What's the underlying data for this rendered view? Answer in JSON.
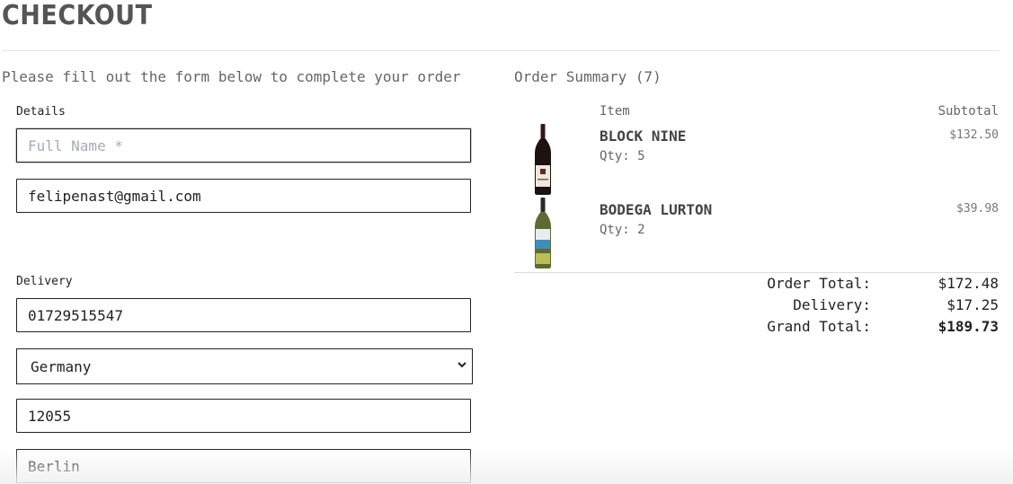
{
  "page": {
    "title": "CHECKOUT",
    "intro": "Please fill out the form below to complete your order"
  },
  "form": {
    "details_label": "Details",
    "full_name": {
      "value": "",
      "placeholder": "Full Name *"
    },
    "email": {
      "value": "felipenast@gmail.com"
    },
    "delivery_label": "Delivery",
    "phone": {
      "value": "01729515547"
    },
    "country": {
      "value": "Germany"
    },
    "postcode": {
      "value": "12055"
    },
    "city": {
      "value": "Berlin"
    }
  },
  "summary": {
    "title": "Order Summary (7)",
    "col_item": "Item",
    "col_subtotal": "Subtotal",
    "items": [
      {
        "name": "BLOCK NINE",
        "qty": "Qty: 5",
        "subtotal": "$132.50"
      },
      {
        "name": "BODEGA LURTON",
        "qty": "Qty: 2",
        "subtotal": "$39.98"
      }
    ],
    "order_total_label": "Order Total:",
    "order_total": "$172.48",
    "delivery_label": "Delivery:",
    "delivery": "$17.25",
    "grand_total_label": "Grand Total:",
    "grand_total": "$189.73"
  }
}
